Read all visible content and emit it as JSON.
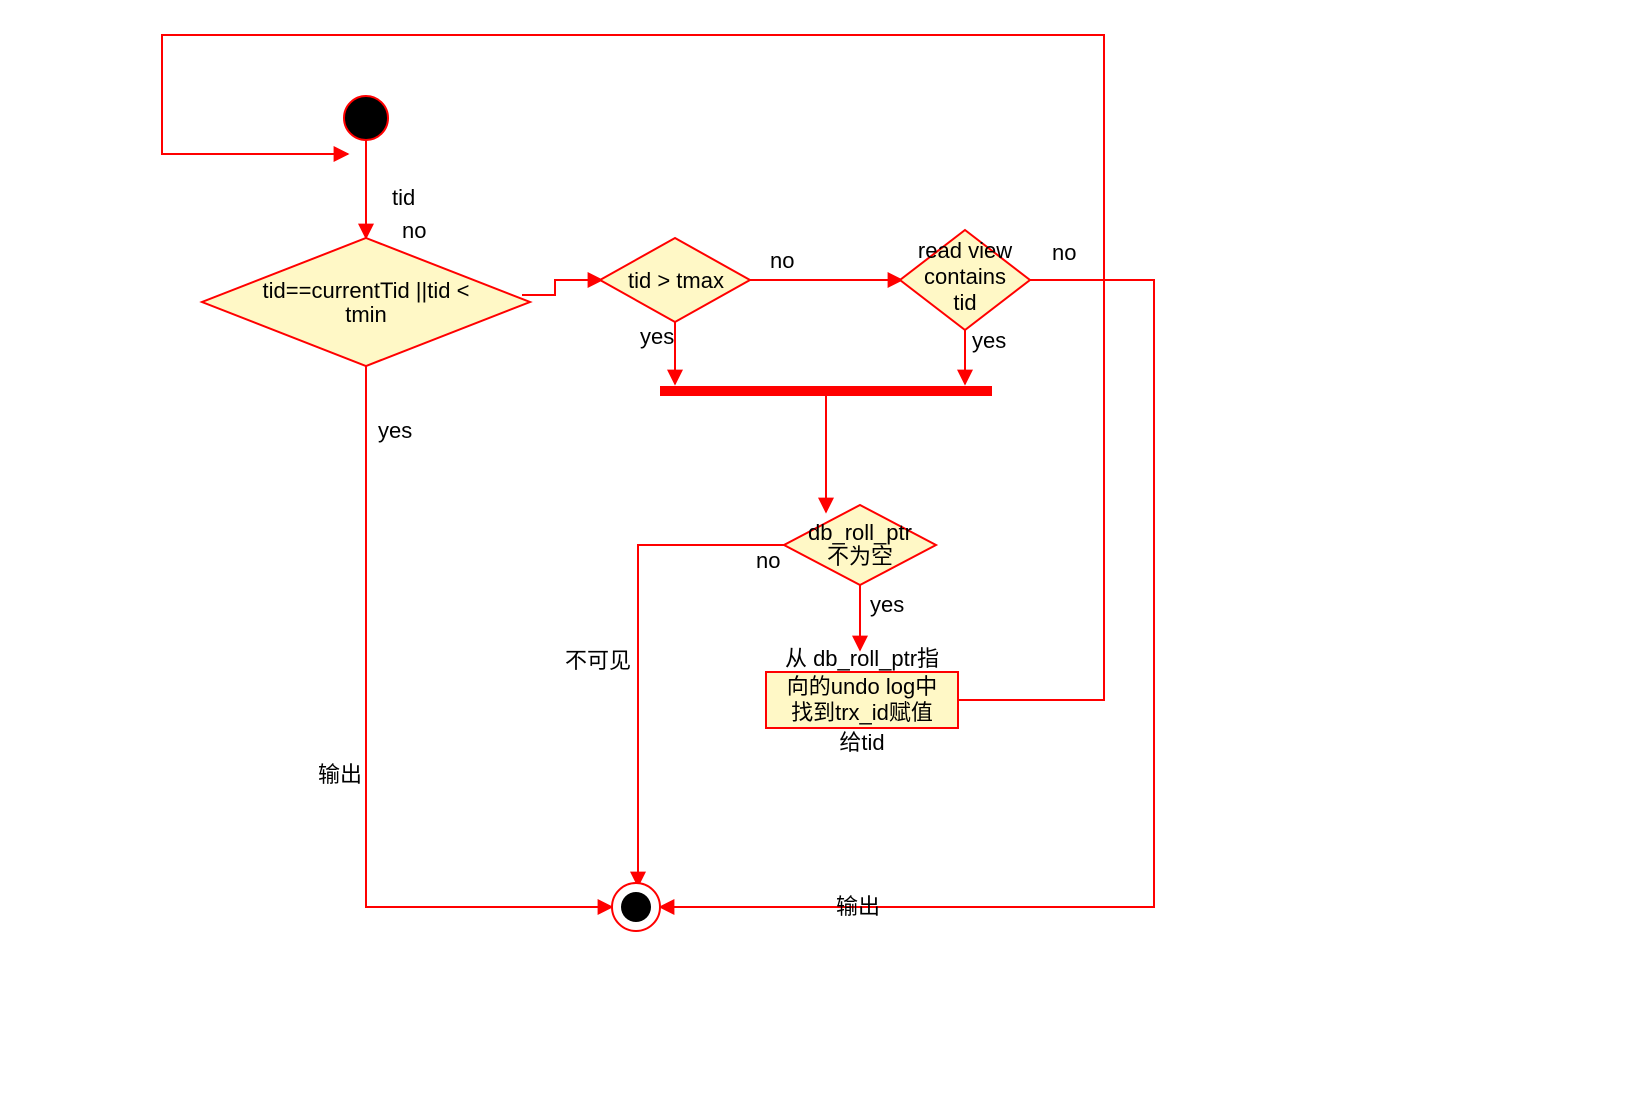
{
  "nodes": {
    "start": {
      "type": "initial"
    },
    "d1": {
      "type": "decision",
      "line1": "tid==currentTid ||tid <",
      "line2": "tmin"
    },
    "d2": {
      "type": "decision",
      "label": "tid > tmax"
    },
    "d3": {
      "type": "decision",
      "line1": "read view",
      "line2": "contains",
      "line3": "tid"
    },
    "d4": {
      "type": "decision",
      "line1": "db_roll_ptr",
      "line2": "不为空"
    },
    "actionUndo": {
      "type": "action",
      "line1": "从 db_roll_ptr指",
      "line2": "向的undo log中",
      "line3": "找到trx_id赋值",
      "line4": "给tid"
    },
    "end": {
      "type": "final"
    }
  },
  "labels": {
    "tidLabel": "tid",
    "d1_no": "no",
    "d1_yes": "yes",
    "d2_no": "no",
    "d2_yes": "yes",
    "d3_no": "no",
    "d3_yes": "yes",
    "d4_no": "no",
    "d4_yes": "yes",
    "d1_yes_edge": "输出",
    "d4_no_edge": "不可见",
    "d3_no_edge": "输出"
  }
}
